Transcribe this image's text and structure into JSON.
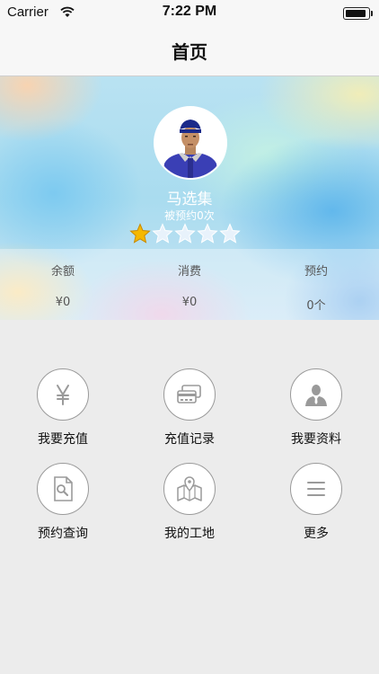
{
  "status_bar": {
    "carrier": "Carrier",
    "time": "7:22 PM",
    "battery_level": 0.9
  },
  "nav": {
    "title": "首页"
  },
  "profile": {
    "name": "马选集",
    "booked_text": "被预约0次",
    "rating": 1,
    "rating_max": 5,
    "stats": [
      {
        "label": "余额",
        "value": "¥0"
      },
      {
        "label": "消费",
        "value": "¥0"
      },
      {
        "label": "预约",
        "value": "0个"
      }
    ]
  },
  "menu": [
    {
      "label": "我要充值",
      "icon": "yen-icon"
    },
    {
      "label": "充值记录",
      "icon": "credit-card-icon"
    },
    {
      "label": "我要资料",
      "icon": "user-profile-icon"
    },
    {
      "label": "预约查询",
      "icon": "document-search-icon"
    },
    {
      "label": "我的工地",
      "icon": "map-pin-icon"
    },
    {
      "label": "更多",
      "icon": "menu-lines-icon"
    }
  ],
  "colors": {
    "star_active": "#f5b800",
    "star_inactive": "#e8f2fb",
    "icon_gray": "#9a9a9a"
  }
}
